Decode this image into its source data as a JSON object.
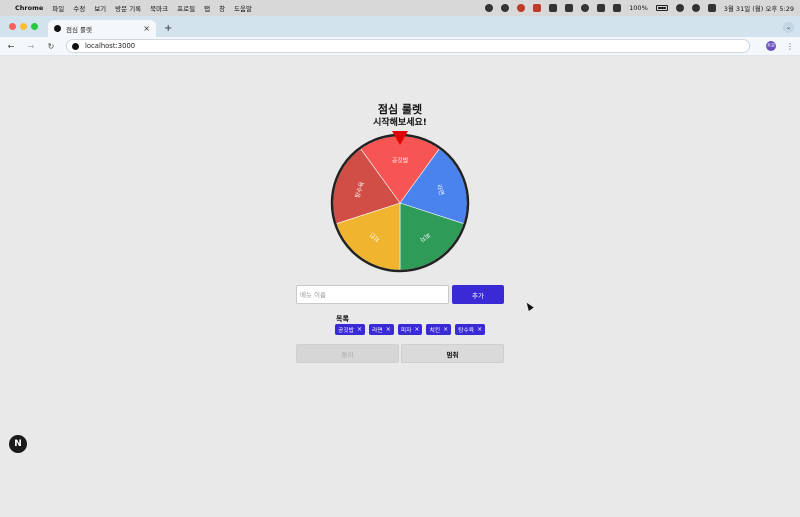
{
  "menubar": {
    "app_name": "Chrome",
    "menus": [
      "파일",
      "수정",
      "보기",
      "방문 기록",
      "북마크",
      "프로필",
      "탭",
      "창",
      "도움말"
    ],
    "battery": "100%",
    "datetime": "3월 31일 (월) 오후 5:29"
  },
  "browser": {
    "tab_title": "점심 룰렛",
    "url": "localhost:3000",
    "profile_initials": "프로"
  },
  "app": {
    "title": "점심 룰렛",
    "subtitle": "시작해보세요!",
    "input_placeholder": "메뉴 이름",
    "input_value": "",
    "add_button": "추가",
    "list_label": "목록",
    "items": [
      "공깃밥",
      "라면",
      "피자",
      "치킨",
      "탕수육"
    ],
    "spin_button": "돌리",
    "stop_button": "멈춰",
    "wheel": {
      "slices": [
        {
          "label": "공깃밥",
          "color": "#f75454"
        },
        {
          "label": "라면",
          "color": "#4a82ee"
        },
        {
          "label": "피자",
          "color": "#2e9b58"
        },
        {
          "label": "치킨",
          "color": "#f0b42e"
        },
        {
          "label": "탕수육",
          "color": "#d04e45"
        }
      ],
      "pointer_color": "#e00000",
      "border_color": "#222222"
    }
  },
  "dev_badge": "N"
}
